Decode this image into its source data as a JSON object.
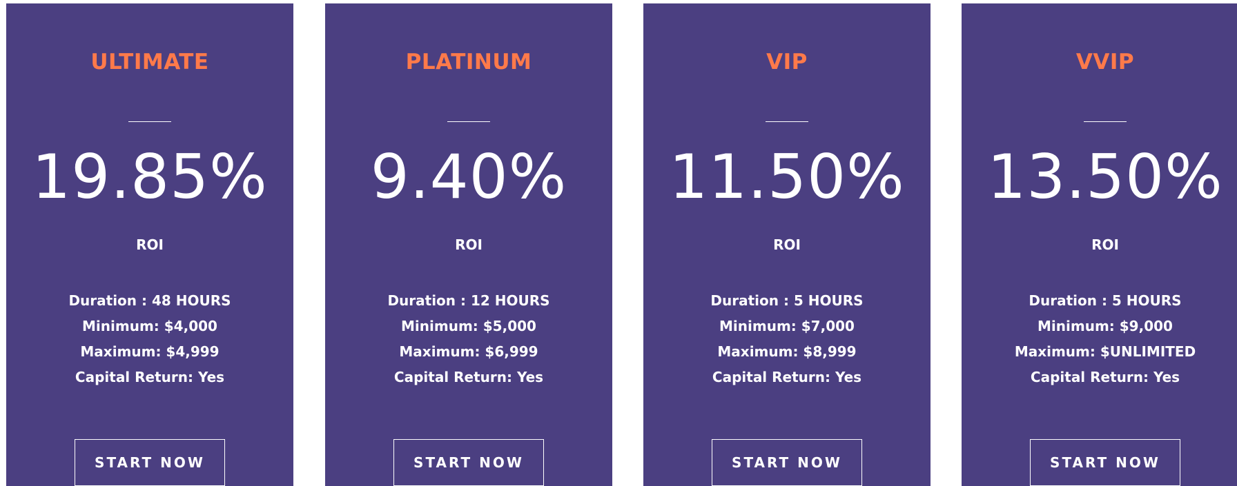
{
  "plans": [
    {
      "name": "ULTIMATE",
      "rate": "19.85%",
      "roi_label": "ROI",
      "duration": "Duration : 48 HOURS",
      "minimum": "Minimum: $4,000",
      "maximum": "Maximum: $4,999",
      "capital_return": "Capital Return: Yes",
      "button_label": "START NOW"
    },
    {
      "name": "PLATINUM",
      "rate": "9.40%",
      "roi_label": "ROI",
      "duration": "Duration : 12 HOURS",
      "minimum": "Minimum: $5,000",
      "maximum": "Maximum: $6,999",
      "capital_return": "Capital Return: Yes",
      "button_label": "START NOW"
    },
    {
      "name": "VIP",
      "rate": "11.50%",
      "roi_label": "ROI",
      "duration": "Duration : 5 HOURS",
      "minimum": "Minimum: $7,000",
      "maximum": "Maximum: $8,999",
      "capital_return": "Capital Return: Yes",
      "button_label": "START NOW"
    },
    {
      "name": "VVIP",
      "rate": "13.50%",
      "roi_label": "ROI",
      "duration": "Duration : 5 HOURS",
      "minimum": "Minimum: $9,000",
      "maximum": "Maximum: $UNLIMITED",
      "capital_return": "Capital Return: Yes",
      "button_label": "START NOW"
    }
  ],
  "colors": {
    "card_background": "#4b3f81",
    "plan_name": "#ff7a4a",
    "text": "#ffffff",
    "page_background": "#ffffff"
  }
}
